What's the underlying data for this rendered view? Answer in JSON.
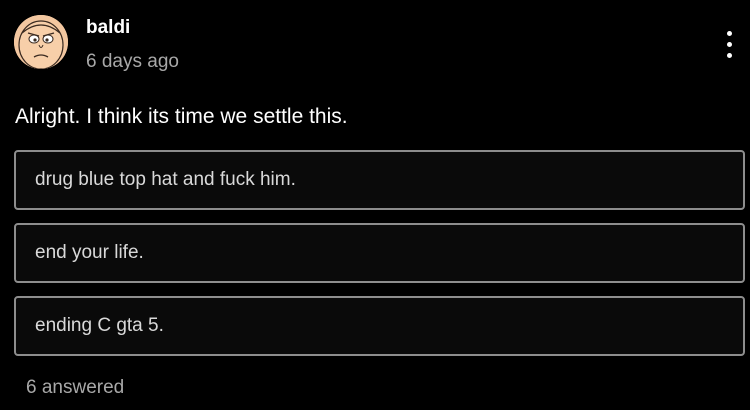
{
  "post": {
    "author": "baldi",
    "timestamp": "6 days ago",
    "question": "Alright. I think its time we settle this.",
    "options": [
      {
        "label": "drug blue top hat and fuck him."
      },
      {
        "label": "end your life."
      },
      {
        "label": "ending C gta 5."
      }
    ],
    "answered": "6 answered"
  },
  "icons": {
    "avatar": "cartoon-face-avatar",
    "menu": "more-vertical-icon"
  },
  "colors": {
    "background": "#000000",
    "text_primary": "#ffffff",
    "text_secondary": "#a8a8a8",
    "option_border": "#8d8d8d"
  }
}
